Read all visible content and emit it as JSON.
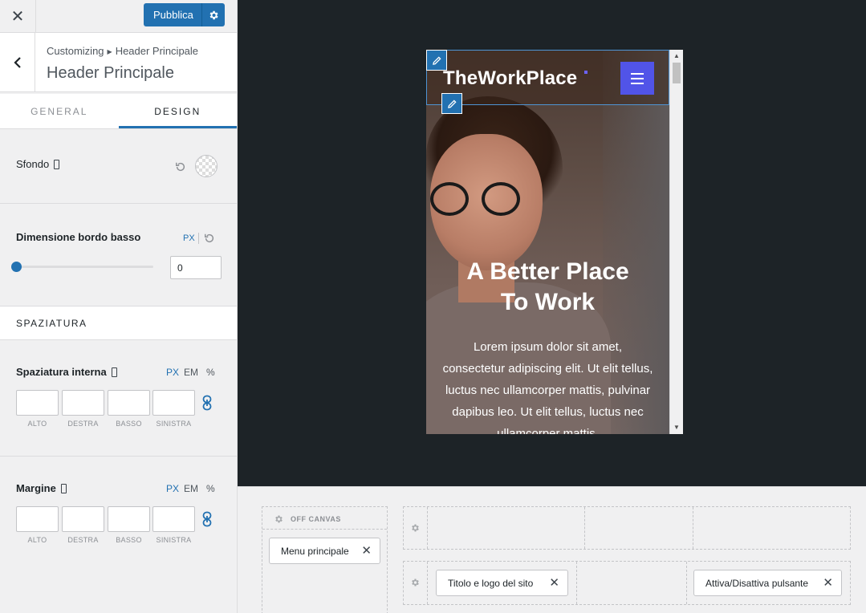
{
  "topbar": {
    "close_icon": "close-icon",
    "publish_label": "Pubblica",
    "publish_settings_icon": "gear-icon"
  },
  "section": {
    "breadcrumb_root": "Customizing",
    "breadcrumb_current": "Header Principale",
    "title": "Header Principale"
  },
  "tabs": [
    {
      "label": "GENERAL"
    },
    {
      "label": "DESIGN",
      "active": true
    }
  ],
  "controls": {
    "background_label": "Sfondo",
    "border_label": "Dimensione bordo basso",
    "border_unit": "PX",
    "border_value": "0",
    "border_level": 0,
    "spacing_header": "SPAZIATURA",
    "padding": {
      "label": "Spaziatura interna",
      "units": [
        "PX",
        "EM",
        "%"
      ],
      "fields": [
        "ALTO",
        "DESTRA",
        "BASSO",
        "SINISTRA"
      ]
    },
    "margin": {
      "label": "Margine",
      "units": [
        "PX",
        "EM",
        "%"
      ],
      "fields": [
        "ALTO",
        "DESTRA",
        "BASSO",
        "SINISTRA"
      ]
    }
  },
  "preview": {
    "logo_text": "TheWorkPlace",
    "hero_title_line1": "A Better Place",
    "hero_title_line2": "To Work",
    "hero_paragraph": "Lorem ipsum dolor sit amet, consectetur adipiscing elit. Ut elit tellus, luctus nec ullamcorper mattis, pulvinar dapibus leo. Ut elit tellus, luctus nec ullamcorper mattis,",
    "accent_color": "#5154e8"
  },
  "builder": {
    "offcanvas_label": "OFF CANVAS",
    "offcanvas_item": "Menu principale",
    "row_items": [
      "Titolo e logo del sito",
      "Attiva/Disattiva pulsante"
    ]
  },
  "colors": {
    "primary": "#2271b1",
    "panel_bg": "#f0f0f1",
    "preview_bg": "#1d2327"
  }
}
